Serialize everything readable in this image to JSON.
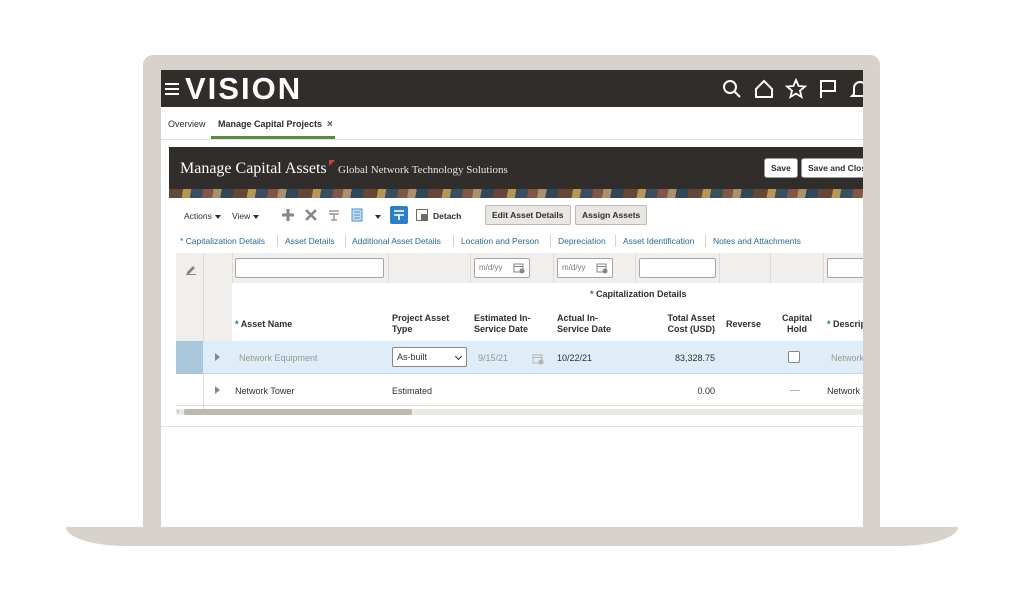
{
  "app": {
    "logo": "VISION"
  },
  "tabs": [
    {
      "label": "Overview"
    },
    {
      "label": "Manage Capital Projects",
      "close": "×"
    }
  ],
  "banner": {
    "title": "Manage Capital Assets",
    "subtitle": "Global Network Technology Solutions",
    "save_label": "Save",
    "save_close_label": "Save and Close"
  },
  "toolbar": {
    "actions_label": "Actions",
    "view_label": "View",
    "detach_label": "Detach",
    "edit_asset_details_label": "Edit Asset Details",
    "assign_assets_label": "Assign Assets"
  },
  "subtabs": [
    "* Capitalization Details",
    "Asset Details",
    "Additional Asset Details",
    "Location and Person",
    "Depreciation",
    "Asset Identification",
    "Notes and Attachments"
  ],
  "filters": {
    "date_placeholder": "m/d/yy"
  },
  "grid": {
    "group_title": "Capitalization Details",
    "required_marker": "*",
    "columns": {
      "asset_name": "Asset Name",
      "project_asset_type_1": "Project Asset",
      "project_asset_type_2": "Type",
      "estimated_1": "Estimated In-",
      "estimated_2": "Service Date",
      "actual_1": "Actual In-",
      "actual_2": "Service Date",
      "total_1": "Total Asset",
      "total_2": "Cost (USD)",
      "reverse": "Reverse",
      "capital_hold_1": "Capital",
      "capital_hold_2": "Hold",
      "description": "Description"
    },
    "rows": [
      {
        "asset_name": "Network Equipment",
        "project_asset_type": "As-built",
        "estimated_date": "9/15/21",
        "actual_date": "10/22/21",
        "total_cost": "83,328.75",
        "description": "Network Equipment"
      },
      {
        "asset_name": "Network Tower",
        "project_asset_type": "Estimated",
        "estimated_date": "",
        "actual_date": "",
        "total_cost": "0.00",
        "description": "Network Tower"
      }
    ]
  }
}
